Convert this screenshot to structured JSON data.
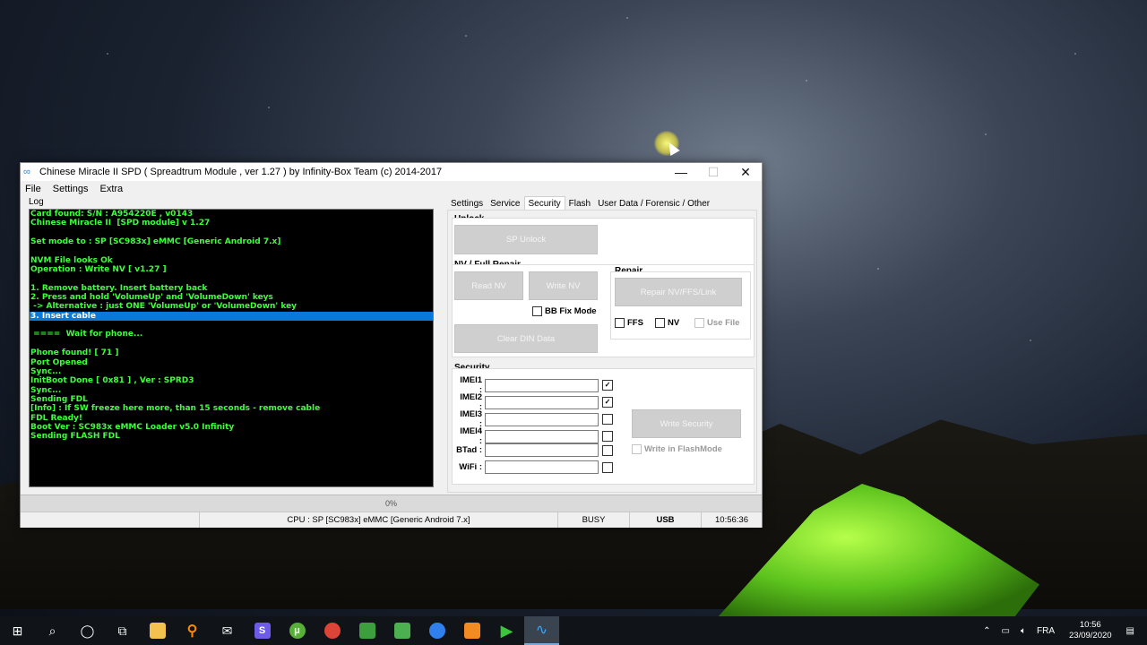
{
  "window": {
    "title": "Chinese Miracle II SPD ( Spreadtrum Module , ver 1.27 ) by Infinity-Box Team (c) 2014-2017",
    "menu": [
      "File",
      "Settings",
      "Extra"
    ]
  },
  "log": {
    "label": "Log",
    "lines": [
      "Card found: S/N : A954220E , v0143",
      "Chinese Miracle II  [SPD module] v 1.27",
      "",
      "Set mode to : SP [SC983x] eMMC [Generic Android 7.x]",
      "",
      "NVM File looks Ok",
      "Operation : Write NV [ v1.27 ]",
      "",
      "1. Remove battery. Insert battery back",
      "2. Press and hold 'VolumeUp' and 'VolumeDown' keys",
      " -> Alternative : just ONE 'VolumeUp' or 'VolumeDown' key",
      "3. Insert cable",
      "",
      " ====  Wait for phone...",
      "",
      "Phone found! [ 71 ]",
      "Port Opened",
      "Sync...",
      "InitBoot Done [ 0x81 ] , Ver : SPRD3",
      "Sync...",
      "Sending FDL",
      "[Info] : If SW freeze here more, than 15 seconds - remove cable",
      "FDL Ready!",
      "Boot Ver : SC983x eMMC Loader v5.0 Infinity",
      "Sending FLASH FDL"
    ],
    "selected_index": 11
  },
  "tabs": [
    "Settings",
    "Service",
    "Security",
    "Flash",
    "User Data / Forensic / Other"
  ],
  "active_tab": "Security",
  "unlock": {
    "label": "Unlock",
    "sp_unlock": "SP Unlock"
  },
  "nv": {
    "label": "NV / Full Repair",
    "read_nv": "Read NV",
    "write_nv": "Write NV",
    "bb_fix_mode": "BB Fix Mode",
    "clear_din": "Clear DIN Data"
  },
  "repair": {
    "label": "Repair",
    "repair_btn": "Repair NV/FFS/Link",
    "ffs": "FFS",
    "nv": "NV",
    "use_file": "Use File"
  },
  "security": {
    "label": "Security",
    "rows": [
      {
        "label": "IMEI1 :",
        "value": "",
        "checked": "✓"
      },
      {
        "label": "IMEI2 :",
        "value": "",
        "checked": "✓"
      },
      {
        "label": "IMEI3 :",
        "value": "",
        "checked": ""
      },
      {
        "label": "IMEI4 :",
        "value": "",
        "checked": ""
      },
      {
        "label": "BTad :",
        "value": "",
        "checked": ""
      },
      {
        "label": "WiFi :",
        "value": "",
        "checked": ""
      }
    ],
    "write_security": "Write Security",
    "write_flashmode": "Write in FlashMode"
  },
  "progress": {
    "text": "0%",
    "value": 0
  },
  "statusbar": {
    "cpu": "CPU : SP [SC983x] eMMC [Generic Android 7.x]",
    "state": "BUSY",
    "conn": "USB",
    "time": "10:56:36"
  },
  "taskbar": {
    "lang": "FRA",
    "time": "10:56",
    "date": "23/09/2020"
  },
  "colors": {
    "log_text": "#3bff3b",
    "selection": "#0a78d7"
  }
}
